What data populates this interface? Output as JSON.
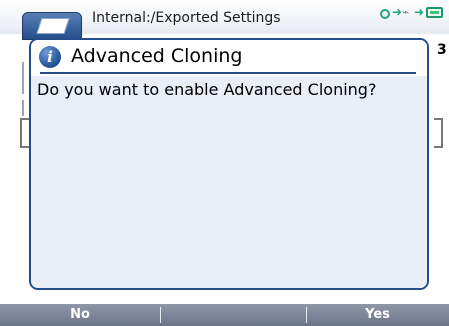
{
  "window": {
    "title": "Internal:/Exported Settings"
  },
  "background": {
    "right_digit": "3"
  },
  "dialog": {
    "title": "Advanced Cloning",
    "message": "Do you want to enable Advanced Cloning?"
  },
  "softkeys": {
    "left_label": "No",
    "right_label": "Yes"
  },
  "colors": {
    "accent": "#234e8b",
    "dialog_body": "#e9eef7",
    "status_green": "#1ea87a",
    "softkey_bar": "#7b8597"
  },
  "icons": {
    "app": "settings-folder-icon",
    "info": "info-icon",
    "network": "network-icon",
    "usb": "usb-icon",
    "battery": "battery-icon"
  }
}
